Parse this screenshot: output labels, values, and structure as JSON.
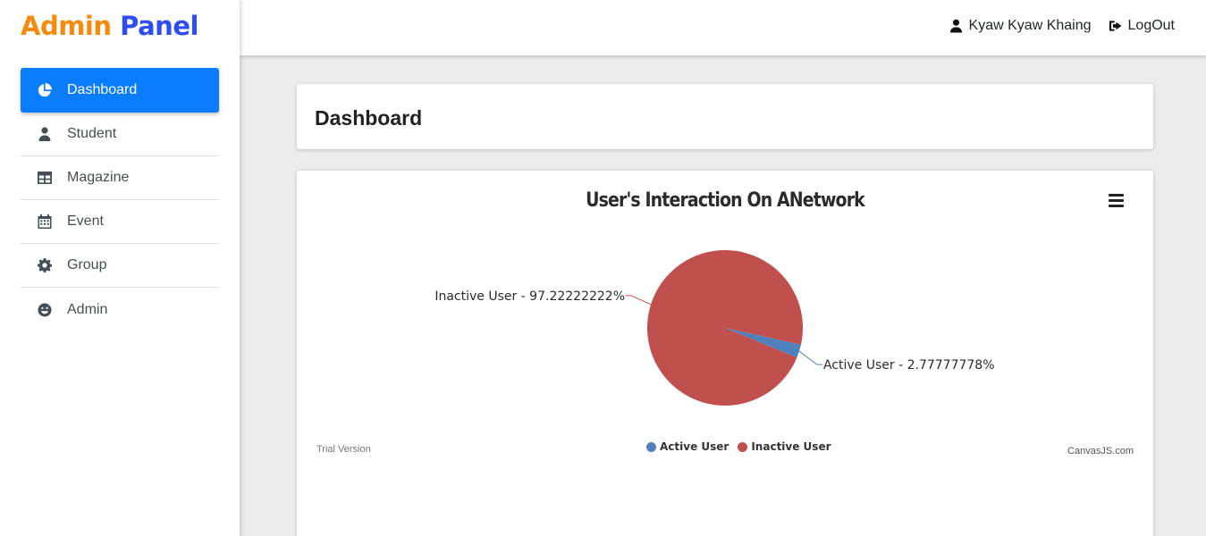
{
  "brand": {
    "part1": "Admin",
    "part2": "Panel"
  },
  "sidebar": {
    "items": [
      {
        "label": "Dashboard",
        "icon": "pie-chart-icon"
      },
      {
        "label": "Student",
        "icon": "user-icon"
      },
      {
        "label": "Magazine",
        "icon": "table-icon"
      },
      {
        "label": "Event",
        "icon": "calendar-icon"
      },
      {
        "label": "Group",
        "icon": "cog-icon"
      },
      {
        "label": "Admin",
        "icon": "smile-icon"
      }
    ]
  },
  "header": {
    "user_name": "Kyaw Kyaw Khaing",
    "logout_label": "LogOut"
  },
  "main": {
    "page_title": "Dashboard"
  },
  "chart": {
    "trial_text": "Trial Version",
    "credit_text": "CanvasJS.com"
  },
  "chart_data": {
    "type": "pie",
    "title": "User's Interaction On ANetwork",
    "slices": [
      {
        "name": "Active User",
        "value": 2.77777778,
        "label": "Active User - 2.77777778%",
        "color": "#4f81bc"
      },
      {
        "name": "Inactive User",
        "value": 97.22222222,
        "label": "Inactive User - 97.22222222%",
        "color": "#c0504e"
      }
    ],
    "legend_position": "bottom"
  },
  "colors": {
    "accent": "#0a7cff",
    "brand_orange": "#f58a0b",
    "brand_blue": "#2e4cf0"
  }
}
